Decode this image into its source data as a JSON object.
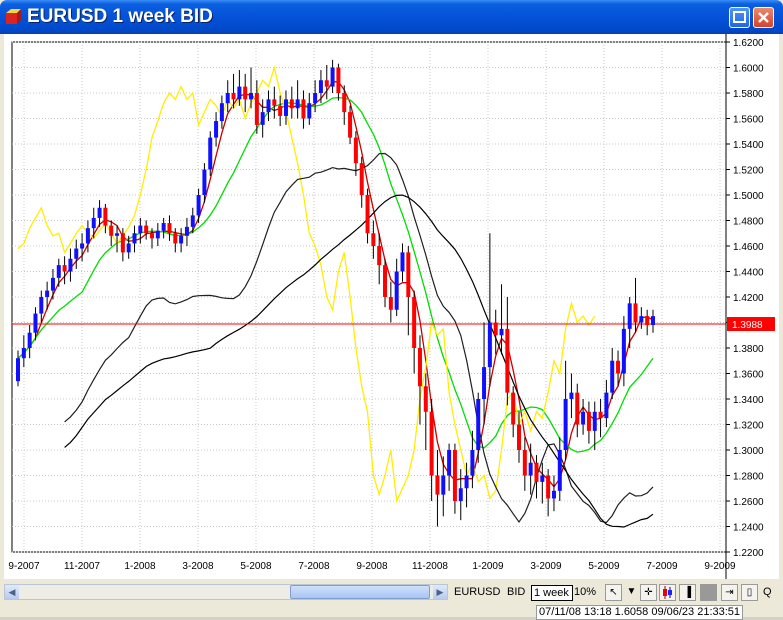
{
  "window": {
    "title": "EURUSD 1 week BID",
    "colors": {
      "titlebar": "#0552d8",
      "chart_bg": "#ffffff",
      "bull_candle": "#1010ff",
      "bear_candle": "#ff0000",
      "price_line": "#ff0000"
    }
  },
  "toolbar": {
    "symbol": "EURUSD",
    "price_type": "BID",
    "period": "1 week",
    "zoom": "10%",
    "icons": [
      "cursor-icon",
      "dropdown-arrow-icon",
      "crosshair-icon",
      "candlestick-icon",
      "bar-chart-icon",
      "scroll-right-icon",
      "zoom-icon"
    ],
    "zoom_letter": "Q"
  },
  "status": {
    "text": "07/11/08 13:18 1.6058 09/06/23 21:33:51"
  },
  "chart_data": {
    "type": "candlestick",
    "title": "EURUSD 1 week BID",
    "y_ticks": [
      "1.6200",
      "1.6000",
      "1.5800",
      "1.5600",
      "1.5400",
      "1.5200",
      "1.5000",
      "1.4800",
      "1.4600",
      "1.4400",
      "1.4200",
      "1.4000",
      "1.3800",
      "1.3600",
      "1.3400",
      "1.3200",
      "1.3000",
      "1.2800",
      "1.2600",
      "1.2400",
      "1.2200"
    ],
    "x_ticks": [
      "9-2007",
      "11-2007",
      "1-2008",
      "3-2008",
      "5-2008",
      "7-2008",
      "9-2008",
      "11-2008",
      "1-2009",
      "3-2009",
      "5-2009",
      "7-2009",
      "9-2009"
    ],
    "ylim": [
      1.22,
      1.62
    ],
    "current_price": "1.3988",
    "current_price_value": 1.3988,
    "candles": [
      [
        1.354,
        1.372,
        1.35,
        1.378
      ],
      [
        1.372,
        1.38,
        1.365,
        1.39
      ],
      [
        1.38,
        1.392,
        1.372,
        1.398
      ],
      [
        1.392,
        1.407,
        1.386,
        1.412
      ],
      [
        1.407,
        1.42,
        1.4,
        1.425
      ],
      [
        1.42,
        1.425,
        1.41,
        1.432
      ],
      [
        1.425,
        1.435,
        1.418,
        1.442
      ],
      [
        1.435,
        1.445,
        1.428,
        1.45
      ],
      [
        1.445,
        1.44,
        1.43,
        1.452
      ],
      [
        1.44,
        1.45,
        1.432,
        1.458
      ],
      [
        1.45,
        1.458,
        1.442,
        1.465
      ],
      [
        1.458,
        1.462,
        1.448,
        1.47
      ],
      [
        1.462,
        1.474,
        1.455,
        1.48
      ],
      [
        1.474,
        1.482,
        1.466,
        1.49
      ],
      [
        1.482,
        1.49,
        1.475,
        1.496
      ],
      [
        1.49,
        1.476,
        1.47,
        1.493
      ],
      [
        1.476,
        1.468,
        1.46,
        1.48
      ],
      [
        1.468,
        1.47,
        1.455,
        1.476
      ],
      [
        1.47,
        1.455,
        1.448,
        1.474
      ],
      [
        1.455,
        1.462,
        1.45,
        1.468
      ],
      [
        1.462,
        1.47,
        1.455,
        1.476
      ],
      [
        1.47,
        1.476,
        1.462,
        1.482
      ],
      [
        1.476,
        1.47,
        1.465,
        1.48
      ],
      [
        1.47,
        1.466,
        1.458,
        1.474
      ],
      [
        1.466,
        1.472,
        1.46,
        1.478
      ],
      [
        1.472,
        1.478,
        1.466,
        1.482
      ],
      [
        1.478,
        1.47,
        1.464,
        1.484
      ],
      [
        1.47,
        1.462,
        1.455,
        1.474
      ],
      [
        1.462,
        1.468,
        1.455,
        1.474
      ],
      [
        1.468,
        1.475,
        1.46,
        1.482
      ],
      [
        1.475,
        1.484,
        1.47,
        1.49
      ],
      [
        1.484,
        1.5,
        1.478,
        1.505
      ],
      [
        1.5,
        1.52,
        1.494,
        1.525
      ],
      [
        1.52,
        1.545,
        1.515,
        1.55
      ],
      [
        1.545,
        1.558,
        1.538,
        1.565
      ],
      [
        1.558,
        1.572,
        1.552,
        1.578
      ],
      [
        1.572,
        1.58,
        1.565,
        1.59
      ],
      [
        1.58,
        1.575,
        1.568,
        1.595
      ],
      [
        1.575,
        1.585,
        1.57,
        1.598
      ],
      [
        1.585,
        1.575,
        1.565,
        1.595
      ],
      [
        1.575,
        1.58,
        1.568,
        1.6
      ],
      [
        1.58,
        1.555,
        1.548,
        1.59
      ],
      [
        1.555,
        1.565,
        1.545,
        1.575
      ],
      [
        1.565,
        1.575,
        1.558,
        1.582
      ],
      [
        1.575,
        1.57,
        1.56,
        1.585
      ],
      [
        1.57,
        1.562,
        1.554,
        1.578
      ],
      [
        1.562,
        1.575,
        1.555,
        1.582
      ],
      [
        1.575,
        1.568,
        1.56,
        1.585
      ],
      [
        1.568,
        1.575,
        1.56,
        1.59
      ],
      [
        1.575,
        1.56,
        1.552,
        1.582
      ],
      [
        1.56,
        1.572,
        1.555,
        1.58
      ],
      [
        1.572,
        1.58,
        1.565,
        1.59
      ],
      [
        1.58,
        1.59,
        1.572,
        1.598
      ],
      [
        1.59,
        1.585,
        1.575,
        1.602
      ],
      [
        1.585,
        1.6,
        1.58,
        1.606
      ],
      [
        1.6,
        1.58,
        1.574,
        1.603
      ],
      [
        1.58,
        1.565,
        1.555,
        1.586
      ],
      [
        1.565,
        1.545,
        1.54,
        1.57
      ],
      [
        1.545,
        1.525,
        1.515,
        1.55
      ],
      [
        1.525,
        1.5,
        1.49,
        1.53
      ],
      [
        1.5,
        1.47,
        1.462,
        1.505
      ],
      [
        1.47,
        1.46,
        1.45,
        1.48
      ],
      [
        1.46,
        1.445,
        1.43,
        1.47
      ],
      [
        1.445,
        1.42,
        1.412,
        1.45
      ],
      [
        1.42,
        1.41,
        1.4,
        1.432
      ],
      [
        1.41,
        1.44,
        1.405,
        1.45
      ],
      [
        1.44,
        1.455,
        1.432,
        1.462
      ],
      [
        1.455,
        1.42,
        1.39,
        1.46
      ],
      [
        1.42,
        1.38,
        1.36,
        1.425
      ],
      [
        1.38,
        1.35,
        1.32,
        1.39
      ],
      [
        1.35,
        1.33,
        1.3,
        1.36
      ],
      [
        1.33,
        1.28,
        1.26,
        1.34
      ],
      [
        1.28,
        1.265,
        1.24,
        1.3
      ],
      [
        1.265,
        1.28,
        1.248,
        1.295
      ],
      [
        1.28,
        1.3,
        1.268,
        1.305
      ],
      [
        1.3,
        1.26,
        1.25,
        1.305
      ],
      [
        1.26,
        1.27,
        1.245,
        1.285
      ],
      [
        1.27,
        1.28,
        1.255,
        1.29
      ],
      [
        1.28,
        1.3,
        1.27,
        1.315
      ],
      [
        1.3,
        1.34,
        1.29,
        1.345
      ],
      [
        1.34,
        1.365,
        1.32,
        1.4
      ],
      [
        1.365,
        1.4,
        1.35,
        1.47
      ],
      [
        1.4,
        1.39,
        1.375,
        1.41
      ],
      [
        1.39,
        1.395,
        1.375,
        1.43
      ],
      [
        1.395,
        1.345,
        1.335,
        1.42
      ],
      [
        1.345,
        1.32,
        1.31,
        1.35
      ],
      [
        1.32,
        1.3,
        1.29,
        1.33
      ],
      [
        1.3,
        1.28,
        1.268,
        1.31
      ],
      [
        1.28,
        1.29,
        1.265,
        1.305
      ],
      [
        1.29,
        1.275,
        1.262,
        1.296
      ],
      [
        1.275,
        1.28,
        1.258,
        1.29
      ],
      [
        1.28,
        1.262,
        1.248,
        1.285
      ],
      [
        1.262,
        1.268,
        1.252,
        1.28
      ],
      [
        1.268,
        1.3,
        1.26,
        1.31
      ],
      [
        1.3,
        1.34,
        1.292,
        1.37
      ],
      [
        1.34,
        1.345,
        1.325,
        1.36
      ],
      [
        1.345,
        1.32,
        1.31,
        1.352
      ],
      [
        1.32,
        1.33,
        1.312,
        1.34
      ],
      [
        1.33,
        1.315,
        1.305,
        1.338
      ],
      [
        1.315,
        1.33,
        1.3,
        1.338
      ],
      [
        1.33,
        1.325,
        1.31,
        1.34
      ],
      [
        1.325,
        1.345,
        1.318,
        1.355
      ],
      [
        1.345,
        1.37,
        1.34,
        1.38
      ],
      [
        1.37,
        1.36,
        1.35,
        1.378
      ],
      [
        1.36,
        1.395,
        1.35,
        1.405
      ],
      [
        1.395,
        1.415,
        1.38,
        1.42
      ],
      [
        1.415,
        1.4,
        1.392,
        1.435
      ],
      [
        1.4,
        1.405,
        1.395,
        1.412
      ],
      [
        1.405,
        1.398,
        1.39,
        1.41
      ],
      [
        1.398,
        1.405,
        1.392,
        1.41
      ]
    ],
    "series": [
      {
        "name": "",
        "color": "#ff0000"
      },
      {
        "name": "",
        "color": "#00cc00"
      },
      {
        "name": "",
        "color": "#ffee00"
      },
      {
        "name": "",
        "color": "#000000"
      }
    ],
    "grid": true
  }
}
